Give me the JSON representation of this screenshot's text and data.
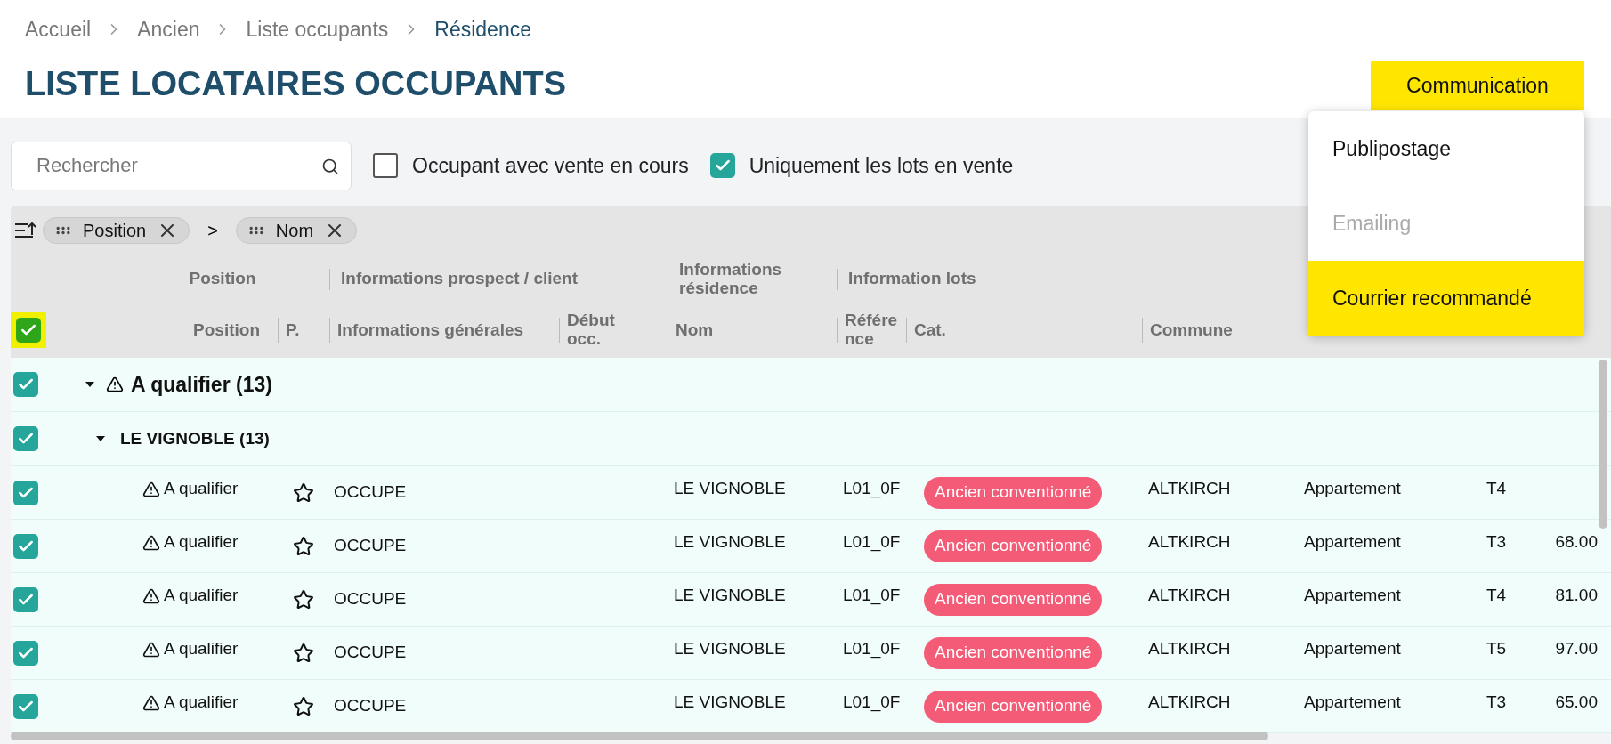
{
  "breadcrumb": [
    {
      "label": "Accueil",
      "current": false
    },
    {
      "label": "Ancien",
      "current": false
    },
    {
      "label": "Liste occupants",
      "current": false
    },
    {
      "label": "Résidence",
      "current": true
    }
  ],
  "title": "LISTE LOCATAIRES OCCUPANTS",
  "communication_button": {
    "label": "Communication"
  },
  "communication_menu": [
    {
      "label": "Publipostage",
      "disabled": false,
      "selected": false
    },
    {
      "label": "Emailing",
      "disabled": true,
      "selected": false
    },
    {
      "label": "Courrier recommandé",
      "disabled": false,
      "selected": true
    }
  ],
  "search": {
    "placeholder": "Rechercher"
  },
  "filters": [
    {
      "label": "Occupant avec vente en cours",
      "checked": false
    },
    {
      "label": "Uniquement les lots en vente",
      "checked": true
    }
  ],
  "grouping_chips": [
    {
      "label": "Position"
    },
    {
      "label": "Nom"
    }
  ],
  "grouping_separator": ">",
  "select_all": {
    "checked": true,
    "highlighted": true
  },
  "column_groups": [
    {
      "label": "Position"
    },
    {
      "label": "Informations prospect / client"
    },
    {
      "label": "Informations résidence"
    },
    {
      "label": "Information lots"
    }
  ],
  "columns": [
    "Position",
    "P.",
    "Informations générales",
    "Début occ.",
    "Nom",
    "Référence",
    "Cat.",
    "Commune"
  ],
  "groups": [
    {
      "label": "A qualifier (13)",
      "checked": true,
      "expanded": true,
      "children": [
        {
          "label": "LE VIGNOBLE (13)",
          "checked": true,
          "expanded": true,
          "rows": [
            {
              "checked": true,
              "position": "A qualifier",
              "starred": false,
              "info": "OCCUPE",
              "nom": "LE VIGNOBLE",
              "reference": "L01_0F",
              "category": "Ancien conventionné",
              "commune": "ALTKIRCH",
              "type": "Appartement",
              "type_code": "T4",
              "surface": ""
            },
            {
              "checked": true,
              "position": "A qualifier",
              "starred": false,
              "info": "OCCUPE",
              "nom": "LE VIGNOBLE",
              "reference": "L01_0F",
              "category": "Ancien conventionné",
              "commune": "ALTKIRCH",
              "type": "Appartement",
              "type_code": "T3",
              "surface": "68.00"
            },
            {
              "checked": true,
              "position": "A qualifier",
              "starred": false,
              "info": "OCCUPE",
              "nom": "LE VIGNOBLE",
              "reference": "L01_0F",
              "category": "Ancien conventionné",
              "commune": "ALTKIRCH",
              "type": "Appartement",
              "type_code": "T4",
              "surface": "81.00"
            },
            {
              "checked": true,
              "position": "A qualifier",
              "starred": false,
              "info": "OCCUPE",
              "nom": "LE VIGNOBLE",
              "reference": "L01_0F",
              "category": "Ancien conventionné",
              "commune": "ALTKIRCH",
              "type": "Appartement",
              "type_code": "T5",
              "surface": "97.00"
            },
            {
              "checked": true,
              "position": "A qualifier",
              "starred": false,
              "info": "OCCUPE",
              "nom": "LE VIGNOBLE",
              "reference": "L01_0F",
              "category": "Ancien conventionné",
              "commune": "ALTKIRCH",
              "type": "Appartement",
              "type_code": "T3",
              "surface": "65.00"
            }
          ]
        }
      ]
    }
  ]
}
